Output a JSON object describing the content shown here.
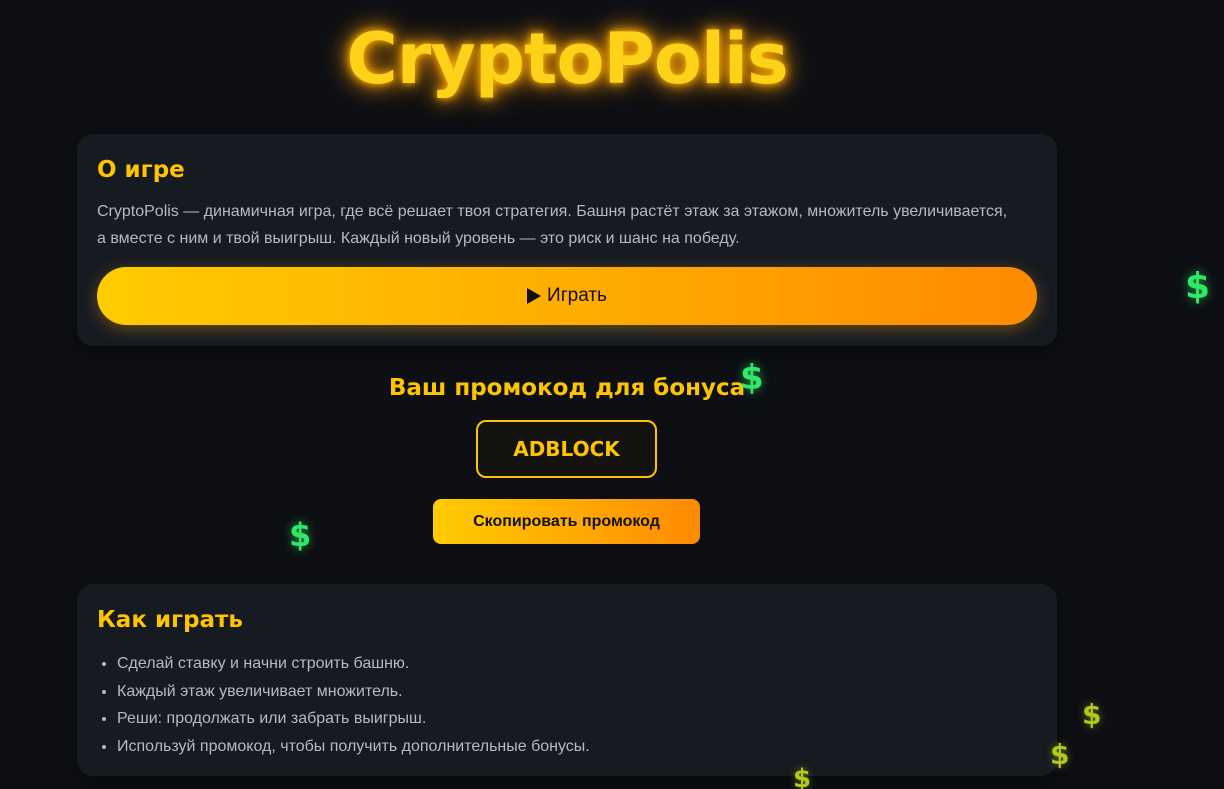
{
  "header": {
    "logo_text": "CryptoPolis"
  },
  "about": {
    "title": "О игре",
    "text": "CryptoPolis — динамичная игра, где всё решает твоя стратегия. Башня растёт этаж за этажом, множитель увеличивается, а вместе с ним и твой выигрыш. Каждый новый уровень — это риск и шанс на победу.",
    "play_label": "Играть",
    "play_icon": "play-icon"
  },
  "promo": {
    "title": "Ваш промокод для бонуса",
    "code": "ADBLOCK",
    "copy_label": "Скопировать промокод"
  },
  "how": {
    "title": "Как играть",
    "items": [
      "Сделай ставку и начни строить башню.",
      "Каждый этаж увеличивает множитель.",
      "Реши: продолжать или забрать выигрыш.",
      "Используй промокод, чтобы получить дополнительные бонусы."
    ]
  },
  "decor": {
    "dollar_symbol": "$",
    "colors": {
      "accent": "#ffc400",
      "background": "#0d0f13",
      "card": "#161a21",
      "dollar_green": "#2ee86a",
      "dollar_olive": "#b3c81a"
    }
  }
}
